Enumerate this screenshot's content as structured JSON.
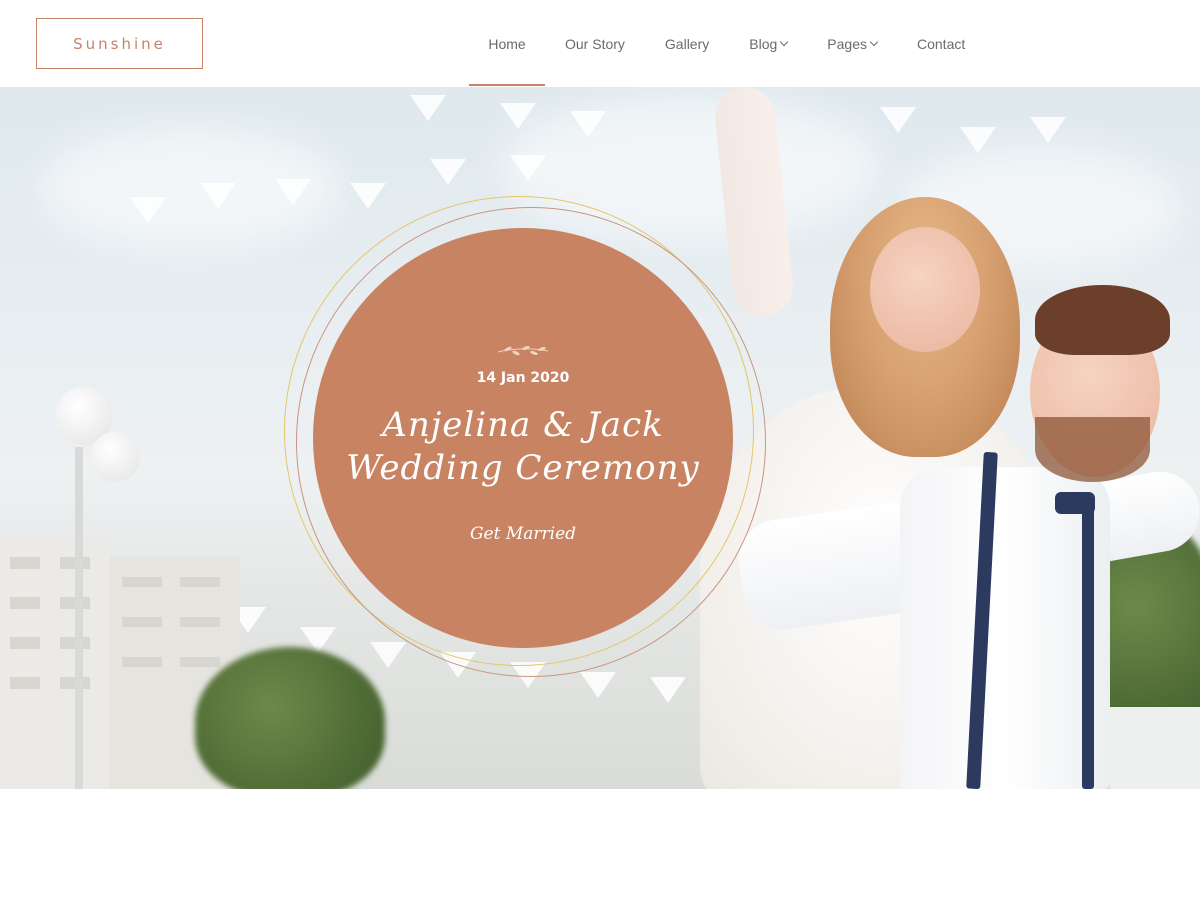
{
  "brand": {
    "logo": "Sunshine"
  },
  "nav": {
    "items": [
      {
        "label": "Home",
        "active": true,
        "dropdown": false
      },
      {
        "label": "Our Story",
        "dropdown": false
      },
      {
        "label": "Gallery",
        "dropdown": false
      },
      {
        "label": "Blog",
        "dropdown": true
      },
      {
        "label": "Pages",
        "dropdown": true
      },
      {
        "label": "Contact",
        "dropdown": false
      }
    ]
  },
  "hero": {
    "date": "14 Jan 2020",
    "title_line1": "Anjelina & Jack",
    "title_line2": "Wedding Ceremony",
    "subtitle": "Get Married"
  },
  "colors": {
    "accent": "#c88363",
    "ring_gold": "#e3c66a",
    "ring_rose": "#c9957f"
  }
}
